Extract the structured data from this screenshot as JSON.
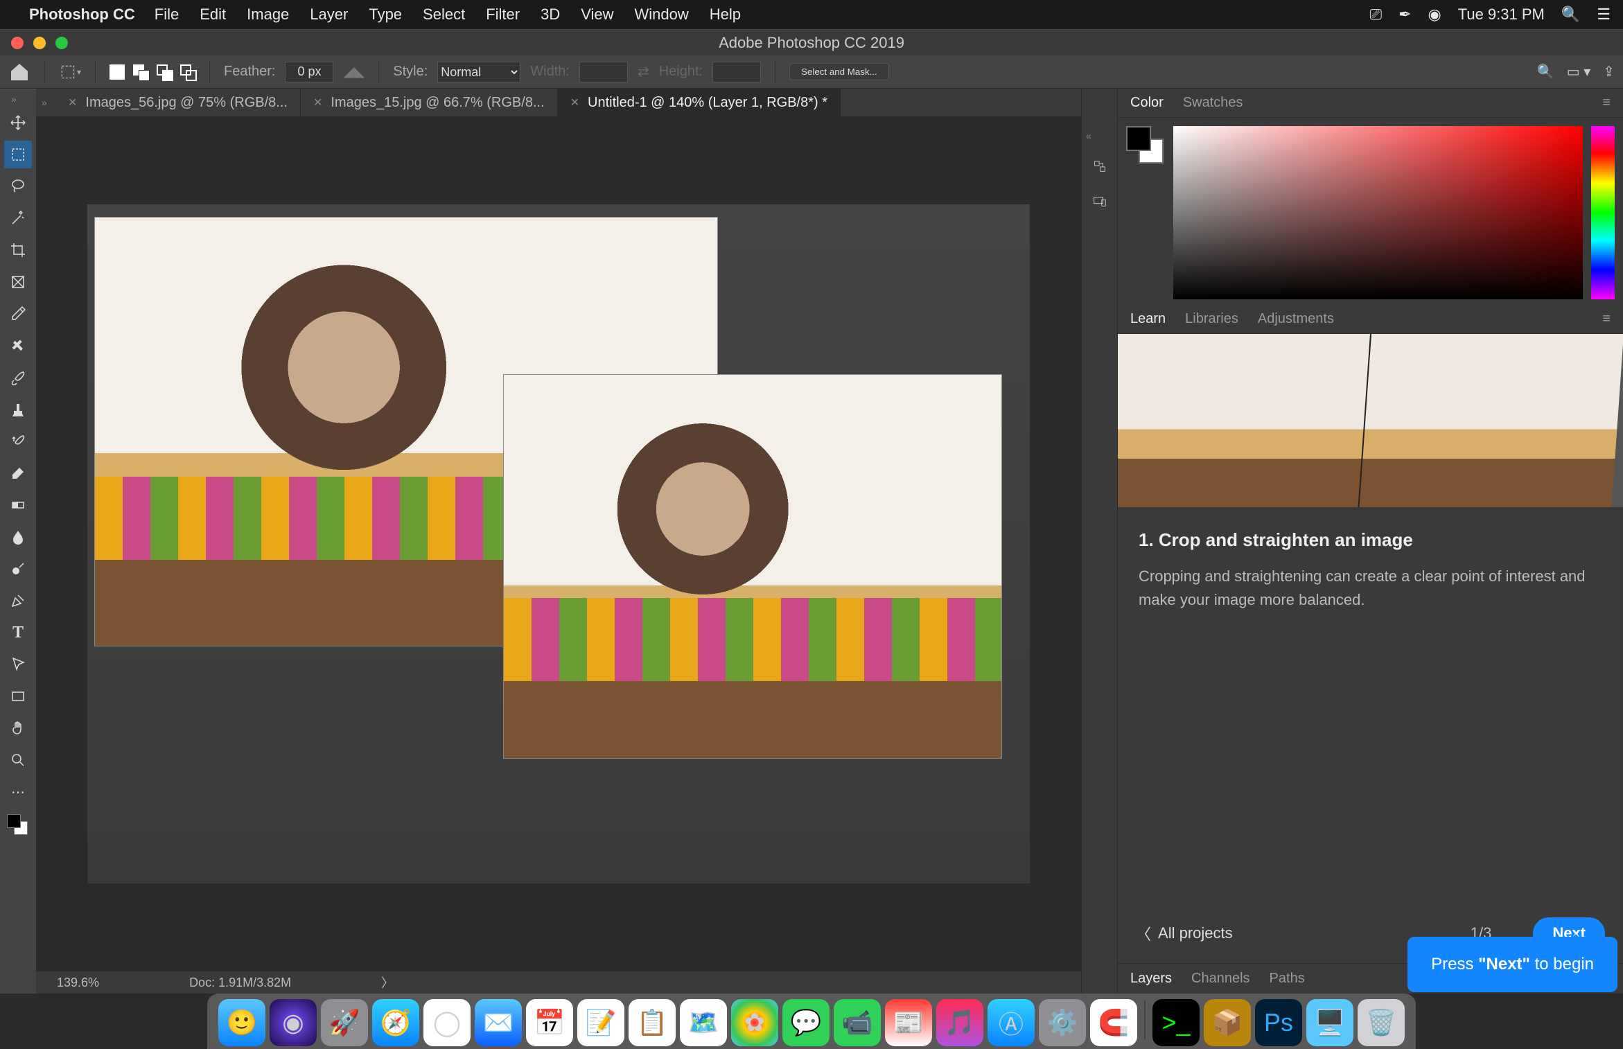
{
  "menubar": {
    "app": "Photoshop CC",
    "items": [
      "File",
      "Edit",
      "Image",
      "Layer",
      "Type",
      "Select",
      "Filter",
      "3D",
      "View",
      "Window",
      "Help"
    ],
    "clock": "Tue 9:31 PM"
  },
  "window": {
    "title": "Adobe Photoshop CC 2019"
  },
  "options": {
    "feather_label": "Feather:",
    "feather_value": "0 px",
    "style_label": "Style:",
    "style_value": "Normal",
    "width_label": "Width:",
    "height_label": "Height:",
    "select_mask": "Select and Mask..."
  },
  "doc_tabs": [
    {
      "label": "Images_56.jpg @ 75% (RGB/8...",
      "active": false
    },
    {
      "label": "Images_15.jpg @ 66.7% (RGB/8...",
      "active": false
    },
    {
      "label": "Untitled-1 @ 140% (Layer 1, RGB/8*) *",
      "active": true
    }
  ],
  "status": {
    "zoom": "139.6%",
    "doc": "Doc: 1.91M/3.82M"
  },
  "panels": {
    "color_tabs": [
      "Color",
      "Swatches"
    ],
    "learn_tabs": [
      "Learn",
      "Libraries",
      "Adjustments"
    ],
    "bottom_tabs": [
      "Layers",
      "Channels",
      "Paths"
    ]
  },
  "learn": {
    "title": "1.  Crop and straighten an image",
    "body": "Cropping and straightening can create a clear point of interest and make your image more balanced.",
    "back": "All projects",
    "counter": "1/3",
    "next": "Next"
  },
  "coach": {
    "text_pre": "Press ",
    "text_bold": "\"Next\"",
    "text_post": " to begin"
  },
  "tools": [
    "move",
    "marquee",
    "lasso",
    "magic-wand",
    "crop",
    "frame",
    "eyedropper",
    "healing",
    "brush",
    "clone",
    "history-brush",
    "eraser",
    "gradient",
    "blur",
    "dodge",
    "pen",
    "type",
    "path-select",
    "rectangle",
    "hand",
    "zoom",
    "more",
    "fgbg"
  ],
  "dock_apps": [
    "finder",
    "siri",
    "launchpad",
    "safari",
    "chrome",
    "mail",
    "calendar",
    "notes",
    "reminders",
    "maps",
    "photos",
    "messages",
    "facetime",
    "news",
    "itunes",
    "appstore",
    "settings",
    "magnet",
    "terminal",
    "box",
    "photoshop",
    "screens",
    "trash"
  ]
}
